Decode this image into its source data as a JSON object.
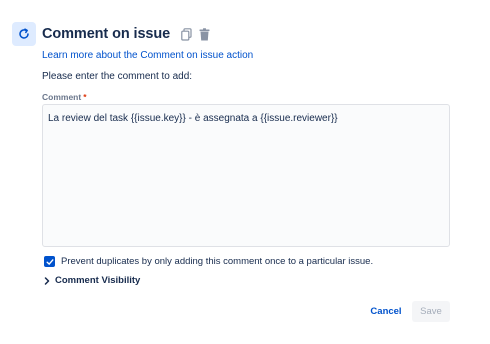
{
  "header": {
    "title": "Comment on issue",
    "action_icon": "refresh-arrow-icon",
    "copy_icon": "copy-icon",
    "delete_icon": "trash-icon"
  },
  "learn_more_link": "Learn more about the Comment on issue action",
  "instructions": "Please enter the comment to add:",
  "comment_field": {
    "label": "Comment",
    "required_marker": "*",
    "value": "La review del task {{issue.key}} - è assegnata a {{issue.reviewer}}"
  },
  "prevent_duplicates": {
    "checked": true,
    "label": "Prevent duplicates by only adding this comment once to a particular issue."
  },
  "visibility_section": {
    "label": "Comment Visibility",
    "expanded": false
  },
  "buttons": {
    "cancel": "Cancel",
    "save": "Save"
  },
  "colors": {
    "accent": "#0052cc",
    "icon_bg": "#deebff",
    "text": "#172b4d",
    "muted": "#6b778c",
    "required": "#de350b",
    "disabled_text": "#a5adba"
  }
}
